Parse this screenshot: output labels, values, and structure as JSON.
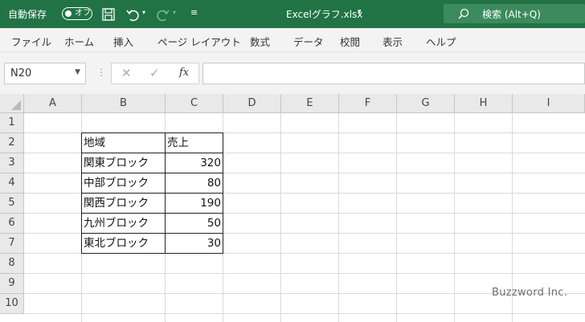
{
  "titlebar": {
    "autosave_label": "自動保存",
    "autosave_state": "オフ",
    "filename": "Excelグラフ.xlsx",
    "search_placeholder": "検索 (Alt+Q)",
    "accent_color": "#217346"
  },
  "ribbon": {
    "tabs": [
      "ファイル",
      "ホーム",
      "挿入",
      "ページ レイアウト",
      "数式",
      "データ",
      "校閲",
      "表示",
      "ヘルプ"
    ]
  },
  "formula_bar": {
    "name_box": "N20",
    "fx_label": "fx",
    "content": ""
  },
  "sheet": {
    "columns": [
      "A",
      "B",
      "C",
      "D",
      "E",
      "F",
      "G",
      "H",
      "I"
    ],
    "rows": [
      "1",
      "2",
      "3",
      "4",
      "5",
      "6",
      "7",
      "8",
      "9",
      "10"
    ],
    "table": {
      "header": [
        "地域",
        "売上"
      ],
      "rows": [
        [
          "関東ブロック",
          "320"
        ],
        [
          "中部ブロック",
          "80"
        ],
        [
          "関西ブロック",
          "190"
        ],
        [
          "九州ブロック",
          "50"
        ],
        [
          "東北ブロック",
          "30"
        ]
      ]
    }
  },
  "watermark": "Buzzword Inc."
}
